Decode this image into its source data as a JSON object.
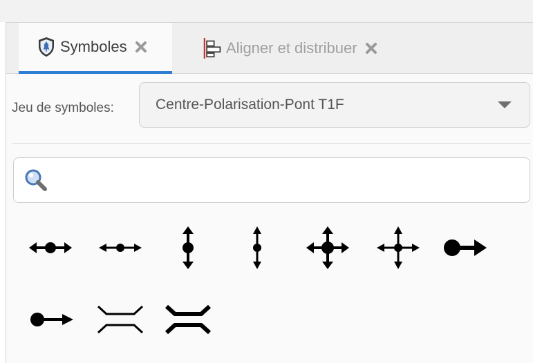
{
  "tabs": [
    {
      "label": "Symboles",
      "icon": "symbols-shield-icon",
      "active": true
    },
    {
      "label": "Aligner et distribuer",
      "icon": "align-distribute-icon",
      "active": false
    }
  ],
  "symbol_set": {
    "label": "Jeu de symboles:",
    "selected": "Centre-Polarisation-Pont T1F"
  },
  "search": {
    "value": "",
    "placeholder": ""
  },
  "symbols": [
    "horizontal-double-arrow-large-dot",
    "horizontal-double-arrow-small-dot",
    "vertical-double-arrow-large-dot",
    "vertical-double-arrow-small-dot",
    "four-way-arrow-large",
    "four-way-arrow-small",
    "dot-with-right-arrow-large",
    "dot-with-right-arrow-small",
    "bridge-thin",
    "bridge-thick"
  ],
  "colors": {
    "accent": "#2d7dd2",
    "close_x": "#9a9a9a",
    "align_icon_red": "#d12b2b"
  }
}
